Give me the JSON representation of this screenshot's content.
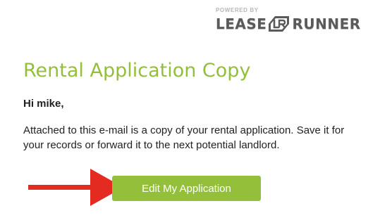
{
  "header": {
    "powered_by": "POWERED BY",
    "logo_left": "LEASE",
    "logo_mark": "LR",
    "logo_right": "RUNNER"
  },
  "email": {
    "title": "Rental Application Copy",
    "greeting": "Hi mike,",
    "body": "Attached to this e-mail is a copy of your rental application. Save it for your records or forward it to the next potential landlord.",
    "button_label": "Edit My Application"
  },
  "colors": {
    "accent_green": "#93bf3b",
    "arrow_red": "#e32b22",
    "logo_gray": "#5a5a5a"
  },
  "icons": {
    "pointer": "arrow-right-icon"
  }
}
